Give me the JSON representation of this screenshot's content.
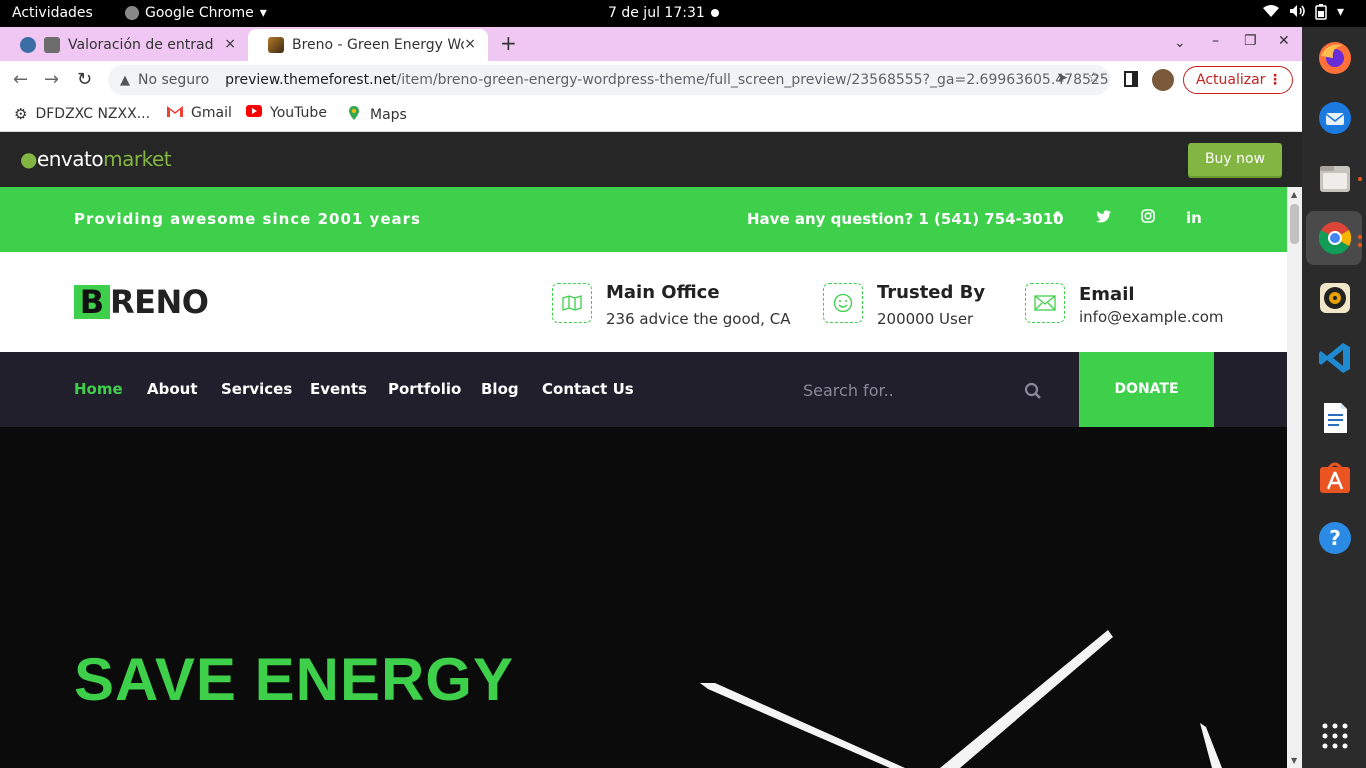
{
  "system": {
    "activities": "Actividades",
    "app_name": "Google Chrome",
    "clock": "7 de jul  17:31"
  },
  "tabs": [
    {
      "title": "Valoración de entrada",
      "close": "×"
    },
    {
      "title": "Breno - Green Energy Wor",
      "close": "×"
    }
  ],
  "toolbar": {
    "insecure_label": "No seguro",
    "url_host": "preview.themeforest.net",
    "url_path": "/item/breno-green-energy-wordpress-theme/full_screen_preview/23568555?_ga=2.69963605.478525...",
    "update_label": "Actualizar"
  },
  "bookmarks": [
    {
      "label": "DFDZXC NZXX..."
    },
    {
      "label": "Gmail"
    },
    {
      "label": "YouTube"
    },
    {
      "label": "Maps"
    }
  ],
  "envato": {
    "logo_main": "envato",
    "logo_market": "market",
    "buy_label": "Buy now"
  },
  "site": {
    "tagline": "Providing awesome since 2001 years",
    "phone": "Have any question? 1 (541) 754-3010",
    "brand_letter": "B",
    "brand_rest": "RENO",
    "info": [
      {
        "title": "Main Office",
        "sub": "236 advice the good, CA",
        "icon": "map-icon"
      },
      {
        "title": "Trusted By",
        "sub": "200000 User",
        "icon": "smile-icon"
      },
      {
        "title": "Email",
        "sub": "info@example.com",
        "icon": "envelope-icon"
      }
    ],
    "nav": [
      "Home",
      "About",
      "Services",
      "Events",
      "Portfolio",
      "Blog",
      "Contact Us"
    ],
    "search_placeholder": "Search for..",
    "donate_label": "DONATE",
    "hero_title": "SAVE ENERGY"
  },
  "colors": {
    "accent_green": "#3ecf4b",
    "nav_bg": "#221f2d",
    "envato_green": "#82b541",
    "tabstrip": "#f0c6f3"
  }
}
